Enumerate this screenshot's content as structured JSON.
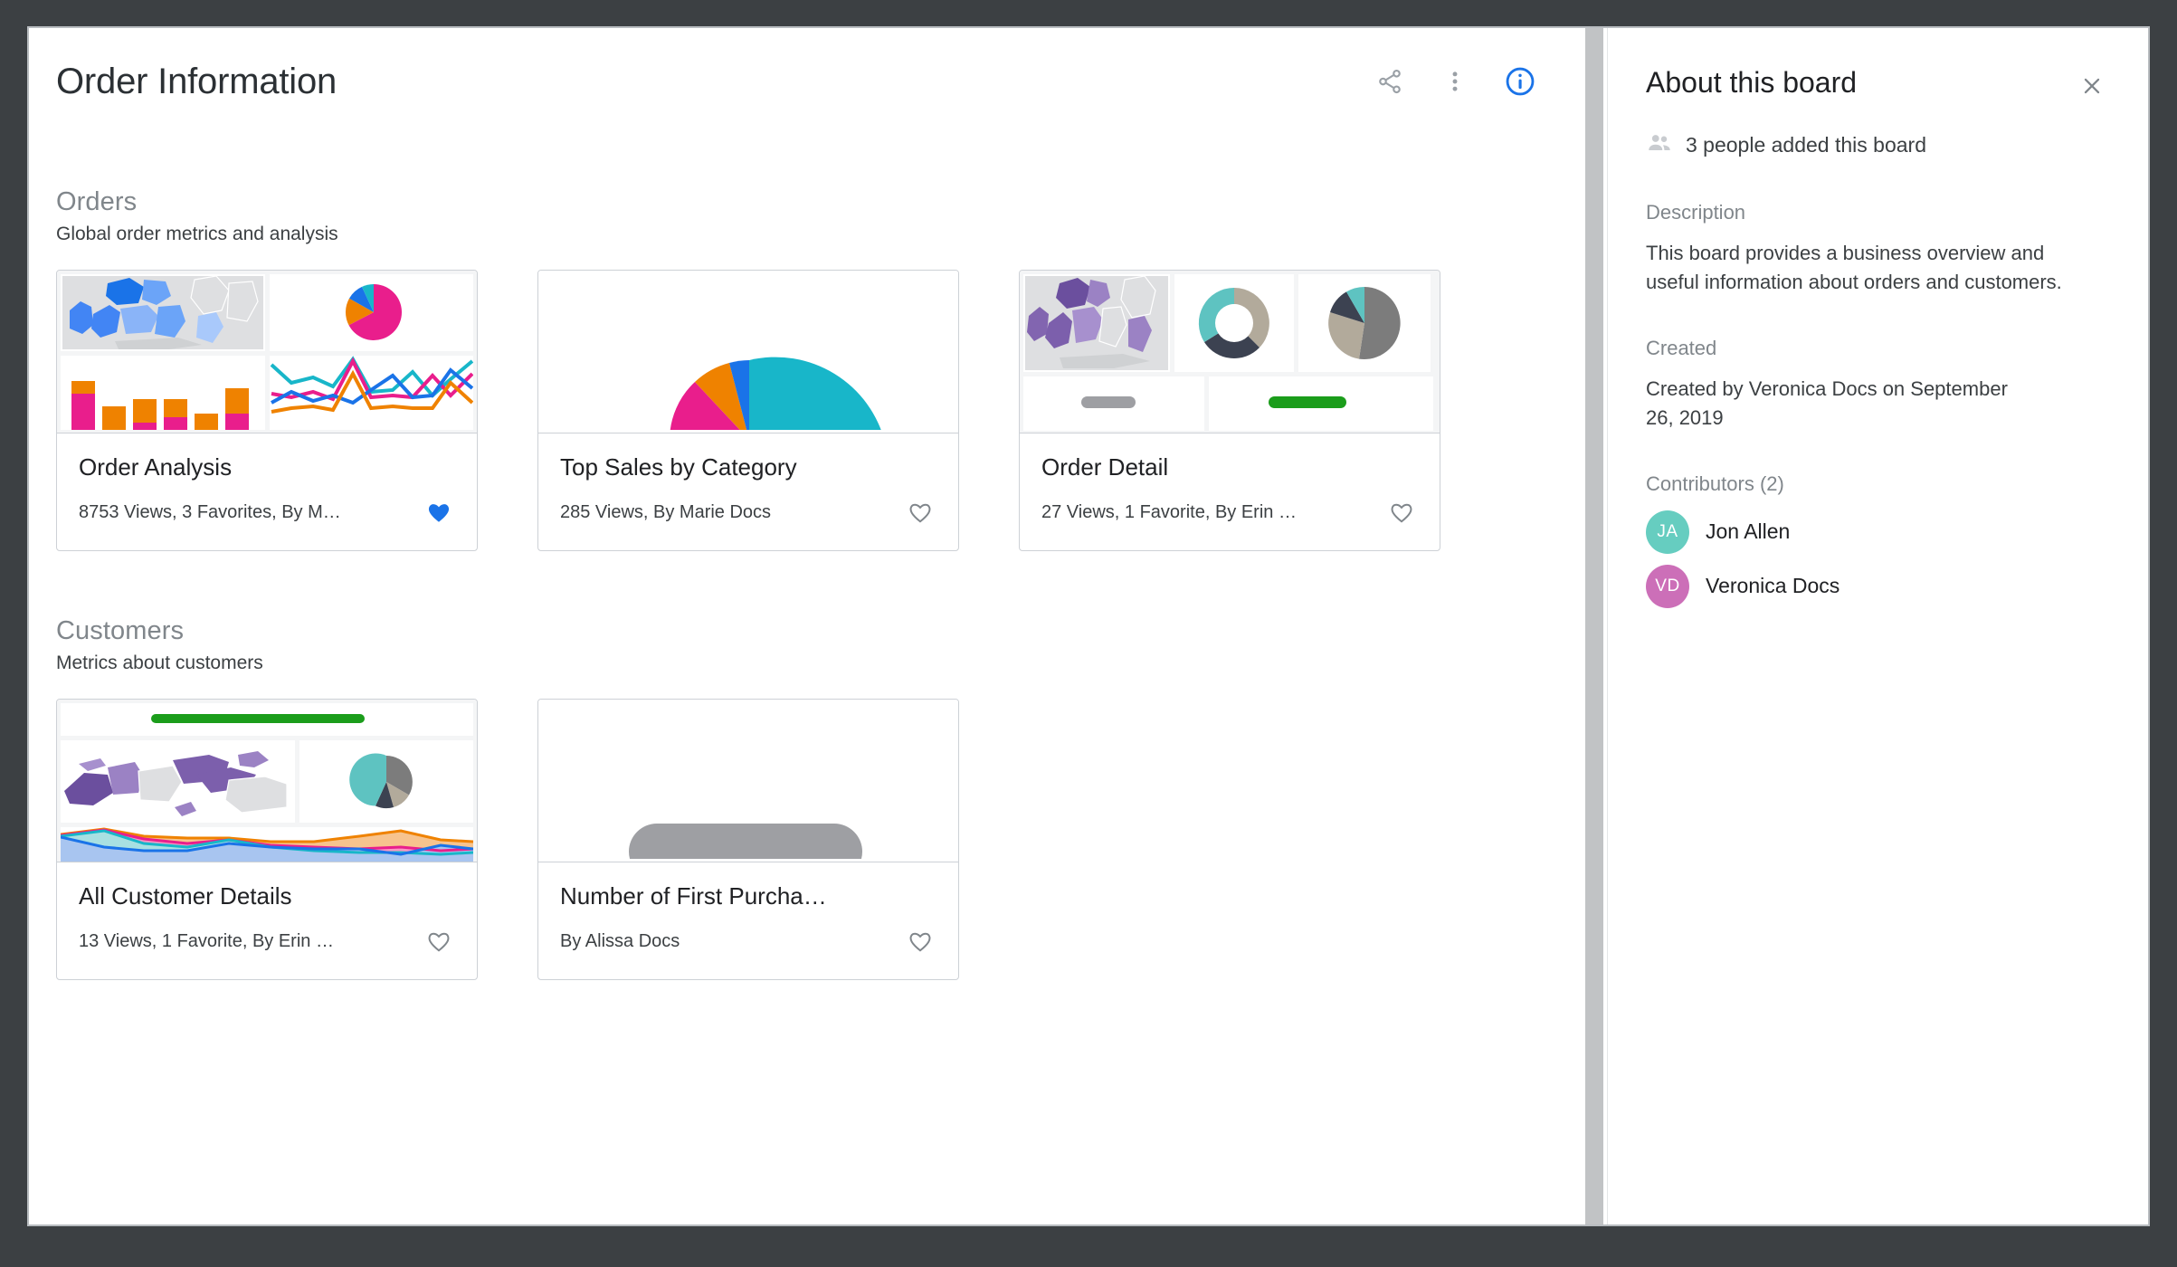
{
  "header": {
    "title": "Order Information",
    "actions": [
      {
        "name": "share-icon",
        "label": "Share"
      },
      {
        "name": "more-vert-icon",
        "label": "More options"
      },
      {
        "name": "info-circle-icon",
        "label": "About this board"
      }
    ]
  },
  "sections": [
    {
      "title": "Orders",
      "subtitle": "Global order metrics and analysis",
      "cards": [
        {
          "title": "Order Analysis",
          "meta": "8753 Views, 3 Favorites, By M…",
          "favorited": true,
          "thumb": "quad-map-pie-bar-line"
        },
        {
          "title": "Top Sales by Category",
          "meta": "285 Views, By Marie Docs",
          "favorited": false,
          "thumb": "big-pie"
        },
        {
          "title": "Order Detail",
          "meta": "27 Views, 1 Favorite, By Erin …",
          "favorited": false,
          "thumb": "map-donut-pie-bars"
        }
      ]
    },
    {
      "title": "Customers",
      "subtitle": "Metrics about customers",
      "cards": [
        {
          "title": "All Customer Details",
          "meta": "13 Views, 1 Favorite, By Erin …",
          "favorited": false,
          "thumb": "greenbar-map-pie-area"
        },
        {
          "title": "Number of First Purcha…",
          "meta": "By Alissa Docs",
          "favorited": false,
          "thumb": "gray-pill"
        }
      ]
    }
  ],
  "sidebar": {
    "title": "About this board",
    "close_label": "Close",
    "people_icon": "people-icon",
    "people_text": "3 people added this board",
    "description_label": "Description",
    "description_text": "This board provides a business overview and useful information about orders and customers.",
    "created_label": "Created",
    "created_text": "Created by Veronica Docs on September 26, 2019",
    "contributors_label": "Contributors (2)",
    "contributors": [
      {
        "initials": "JA",
        "name": "Jon Allen",
        "color": "#66cdc0"
      },
      {
        "initials": "VD",
        "name": "Veronica Docs",
        "color": "#cc6fb8"
      }
    ]
  },
  "colors": {
    "accent_blue": "#1a73e8",
    "favorite_blue": "#1a73e8",
    "frame_dark": "#3c4043",
    "muted_text": "#80868b",
    "card_border": "#cdd1d6",
    "scrollbar": "#c1c3c5",
    "green_bar": "#1b9d1b",
    "gray_bar": "#9e9fa3"
  }
}
